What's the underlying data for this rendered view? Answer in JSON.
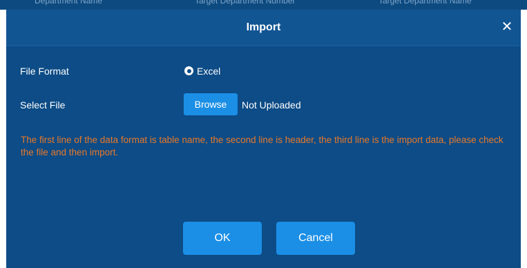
{
  "background": {
    "header_fragments": [
      "Department Name",
      "Target Department Number",
      "Target Department Name"
    ]
  },
  "dialog": {
    "title": "Import",
    "close_icon": "close-icon",
    "fields": {
      "file_format_label": "File Format",
      "file_format_option": "Excel",
      "file_format_selected": true,
      "select_file_label": "Select File",
      "browse_label": "Browse",
      "upload_status": "Not Uploaded"
    },
    "hint": "The first line of the data format is table name, the second line is header, the third line is the import data, please check the file and then import.",
    "buttons": {
      "ok": "OK",
      "cancel": "Cancel"
    }
  },
  "colors": {
    "dialog_bg": "#0d4c86",
    "titlebar_bg": "#125593",
    "button_bg": "#1b8fe6",
    "hint_text": "#e8782a"
  }
}
